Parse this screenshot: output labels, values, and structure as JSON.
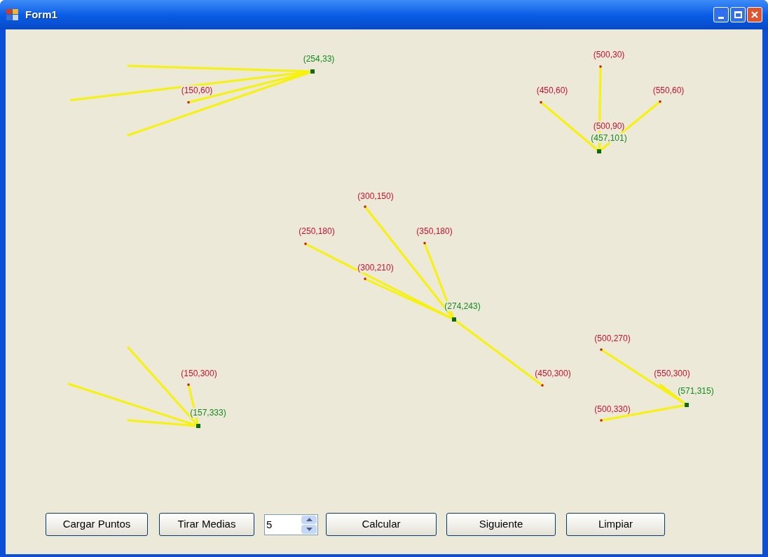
{
  "window": {
    "title": "Form1"
  },
  "canvas": {
    "points": [
      {
        "label": "(500,30)"
      },
      {
        "label": "(150,60)"
      },
      {
        "label": "(450,60)"
      },
      {
        "label": "(550,60)"
      },
      {
        "label": "(500,90)"
      },
      {
        "label": "(300,150)"
      },
      {
        "label": "(250,180)"
      },
      {
        "label": "(350,180)"
      },
      {
        "label": "(300,210)"
      },
      {
        "label": "(500,270)"
      },
      {
        "label": "(150,300)"
      },
      {
        "label": "(450,300)"
      },
      {
        "label": "(550,300)"
      },
      {
        "label": "(500,330)"
      }
    ],
    "centroids": [
      {
        "label": "(254,33)"
      },
      {
        "label": "(457,101)"
      },
      {
        "label": "(274,243)"
      },
      {
        "label": "(571,315)"
      },
      {
        "label": "(157,333)"
      }
    ]
  },
  "controls": {
    "buttons": [
      "Cargar Puntos",
      "Tirar Medias",
      "Calcular",
      "Siguiente",
      "Limpiar"
    ],
    "spinner": {
      "value": "5"
    }
  }
}
